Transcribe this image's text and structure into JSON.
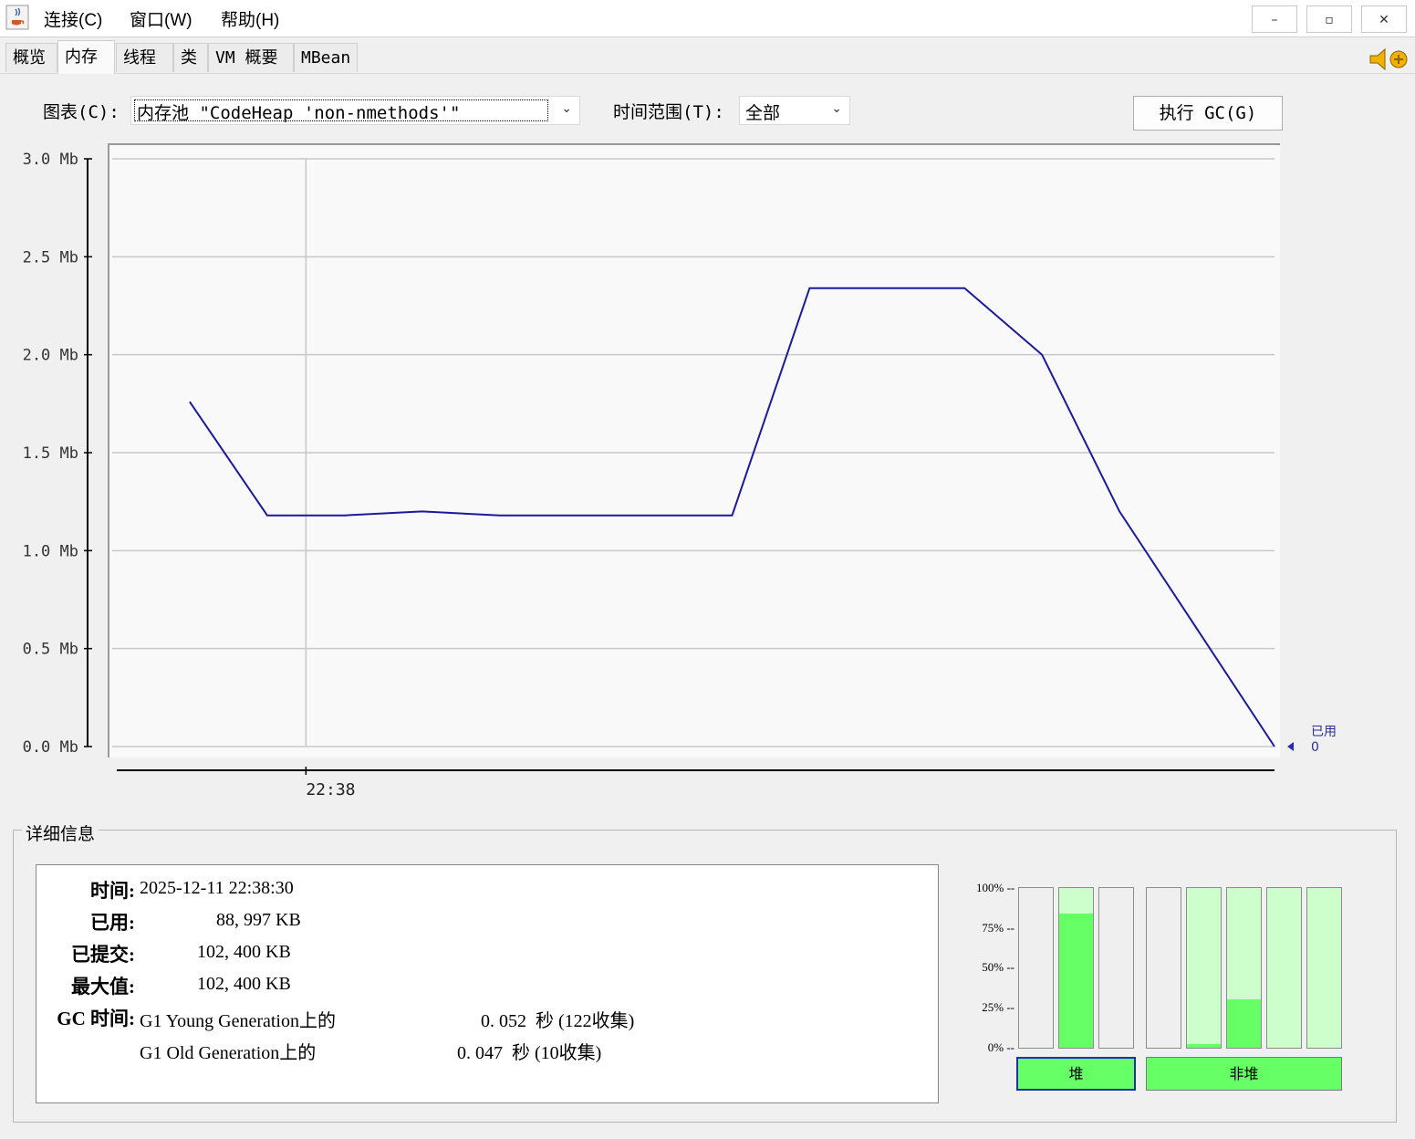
{
  "menu": {
    "items": [
      "连接(C)",
      "窗口(W)",
      "帮助(H)"
    ]
  },
  "window_controls": {
    "minimize": "–",
    "restore": "▫",
    "close": "✕"
  },
  "tabs": [
    "概览",
    "内存",
    "线程",
    "类",
    "VM 概要",
    "MBean"
  ],
  "active_tab": "内存",
  "controls": {
    "chart_label": "图表(C):",
    "chart_value": "内存池 \"CodeHeap 'non-nmethods'\"",
    "time_range_label": "时间范围(T):",
    "time_range_value": "全部",
    "gc_button": "执行 GC(G)"
  },
  "chart_data": {
    "type": "line",
    "series": [
      {
        "name": "已用",
        "color": "#1a1aa0",
        "x": [
          0,
          1,
          2,
          3,
          4,
          5,
          6,
          7,
          8,
          9,
          10,
          11,
          12,
          13,
          14
        ],
        "y": [
          1.76,
          1.18,
          1.18,
          1.2,
          1.18,
          1.18,
          1.18,
          1.18,
          2.34,
          2.34,
          2.34,
          2.0,
          1.2,
          0.6,
          0.0
        ]
      }
    ],
    "ylim": [
      0,
      3.0
    ],
    "xlim": [
      -1,
      14
    ],
    "y_ticks": [
      "3.0 Mb",
      "2.5 Mb",
      "2.0 Mb",
      "1.5 Mb",
      "1.0 Mb",
      "0.5 Mb",
      "0.0 Mb"
    ],
    "y_tick_values": [
      3.0,
      2.5,
      2.0,
      1.5,
      1.0,
      0.5,
      0.0
    ],
    "x_tick_label": "22:38",
    "x_tick_value": 1.5,
    "legend": {
      "label": "已用",
      "value": "0"
    },
    "grid": true
  },
  "details": {
    "title": "详细信息",
    "time_label": "时间:",
    "time_value": "2025-12-11 22:38:30",
    "used_label": "已用:",
    "used_value": "88, 997 KB",
    "committed_label": "已提交:",
    "committed_value": "102, 400 KB",
    "max_label": "最大值:",
    "max_value": "102, 400 KB",
    "gc_label": "GC 时间:",
    "gc_rows": [
      {
        "name": "G1 Young Generation上的",
        "time": "0. 052  秒 (122收集)"
      },
      {
        "name": "G1 Old Generation上的",
        "time": "0. 047  秒 (10收集)"
      }
    ]
  },
  "pool_bars": {
    "percent_labels": [
      "100% --",
      "75% --",
      "50% --",
      "25% --",
      "0% --"
    ],
    "heap_label": "堆",
    "nonheap_label": "非堆",
    "heap": [
      {
        "used": 0.0,
        "committed": 0.0
      },
      {
        "used": 0.84,
        "committed": 1.0
      },
      {
        "used": 0.0,
        "committed": 0.0
      }
    ],
    "nonheap": [
      {
        "used": 0.0,
        "committed": 0.0
      },
      {
        "used": 0.02,
        "committed": 1.0
      },
      {
        "used": 0.3,
        "committed": 1.0
      },
      {
        "used": 0.0,
        "committed": 1.0
      },
      {
        "used": 0.0,
        "committed": 1.0
      }
    ],
    "colors": {
      "used": "#66ff66",
      "committed": "#ccffcc",
      "empty": "#efefef",
      "selected_border": "#1c2fb5"
    }
  }
}
